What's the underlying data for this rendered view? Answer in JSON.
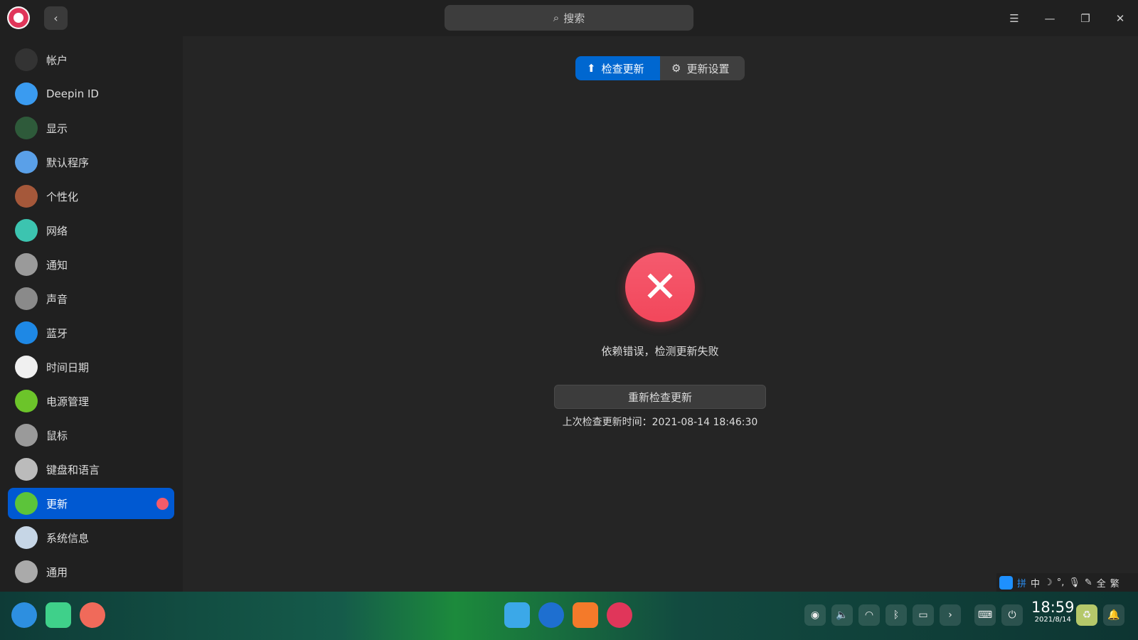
{
  "header": {
    "search_placeholder": "搜索",
    "back": "‹",
    "menu": "☰",
    "minimize": "—",
    "maximize": "❐",
    "close": "✕"
  },
  "sidebar": {
    "items": [
      {
        "label": "帐户",
        "color": "#333"
      },
      {
        "label": "Deepin ID",
        "color": "#3a9bf0"
      },
      {
        "label": "显示",
        "color": "#2e5a3a"
      },
      {
        "label": "默认程序",
        "color": "#5aa0e8"
      },
      {
        "label": "个性化",
        "color": "#a5583a"
      },
      {
        "label": "网络",
        "color": "#3cc4b0"
      },
      {
        "label": "通知",
        "color": "#9a9a9a"
      },
      {
        "label": "声音",
        "color": "#8a8a8a"
      },
      {
        "label": "蓝牙",
        "color": "#1e88e5"
      },
      {
        "label": "时间日期",
        "color": "#f0f0f0"
      },
      {
        "label": "电源管理",
        "color": "#6cc42a"
      },
      {
        "label": "鼠标",
        "color": "#9a9a9a"
      },
      {
        "label": "键盘和语言",
        "color": "#bbbbbb"
      },
      {
        "label": "更新",
        "color": "#5cc43a"
      },
      {
        "label": "系统信息",
        "color": "#c6d6e6"
      },
      {
        "label": "通用",
        "color": "#aaaaaa"
      }
    ],
    "active_index": 13
  },
  "tabs": {
    "check": "检查更新",
    "settings": "更新设置"
  },
  "status": {
    "message": "依赖错误，检测更新失败",
    "retry": "重新检查更新",
    "last_check": "上次检查更新时间：2021-08-14 18:46:30"
  },
  "ime": {
    "items": [
      "拼",
      "中",
      "☽",
      "°,",
      "🎙",
      "✎",
      "全",
      "繁"
    ]
  },
  "taskbar": {
    "time": "18:59",
    "date": "2021/8/14"
  }
}
